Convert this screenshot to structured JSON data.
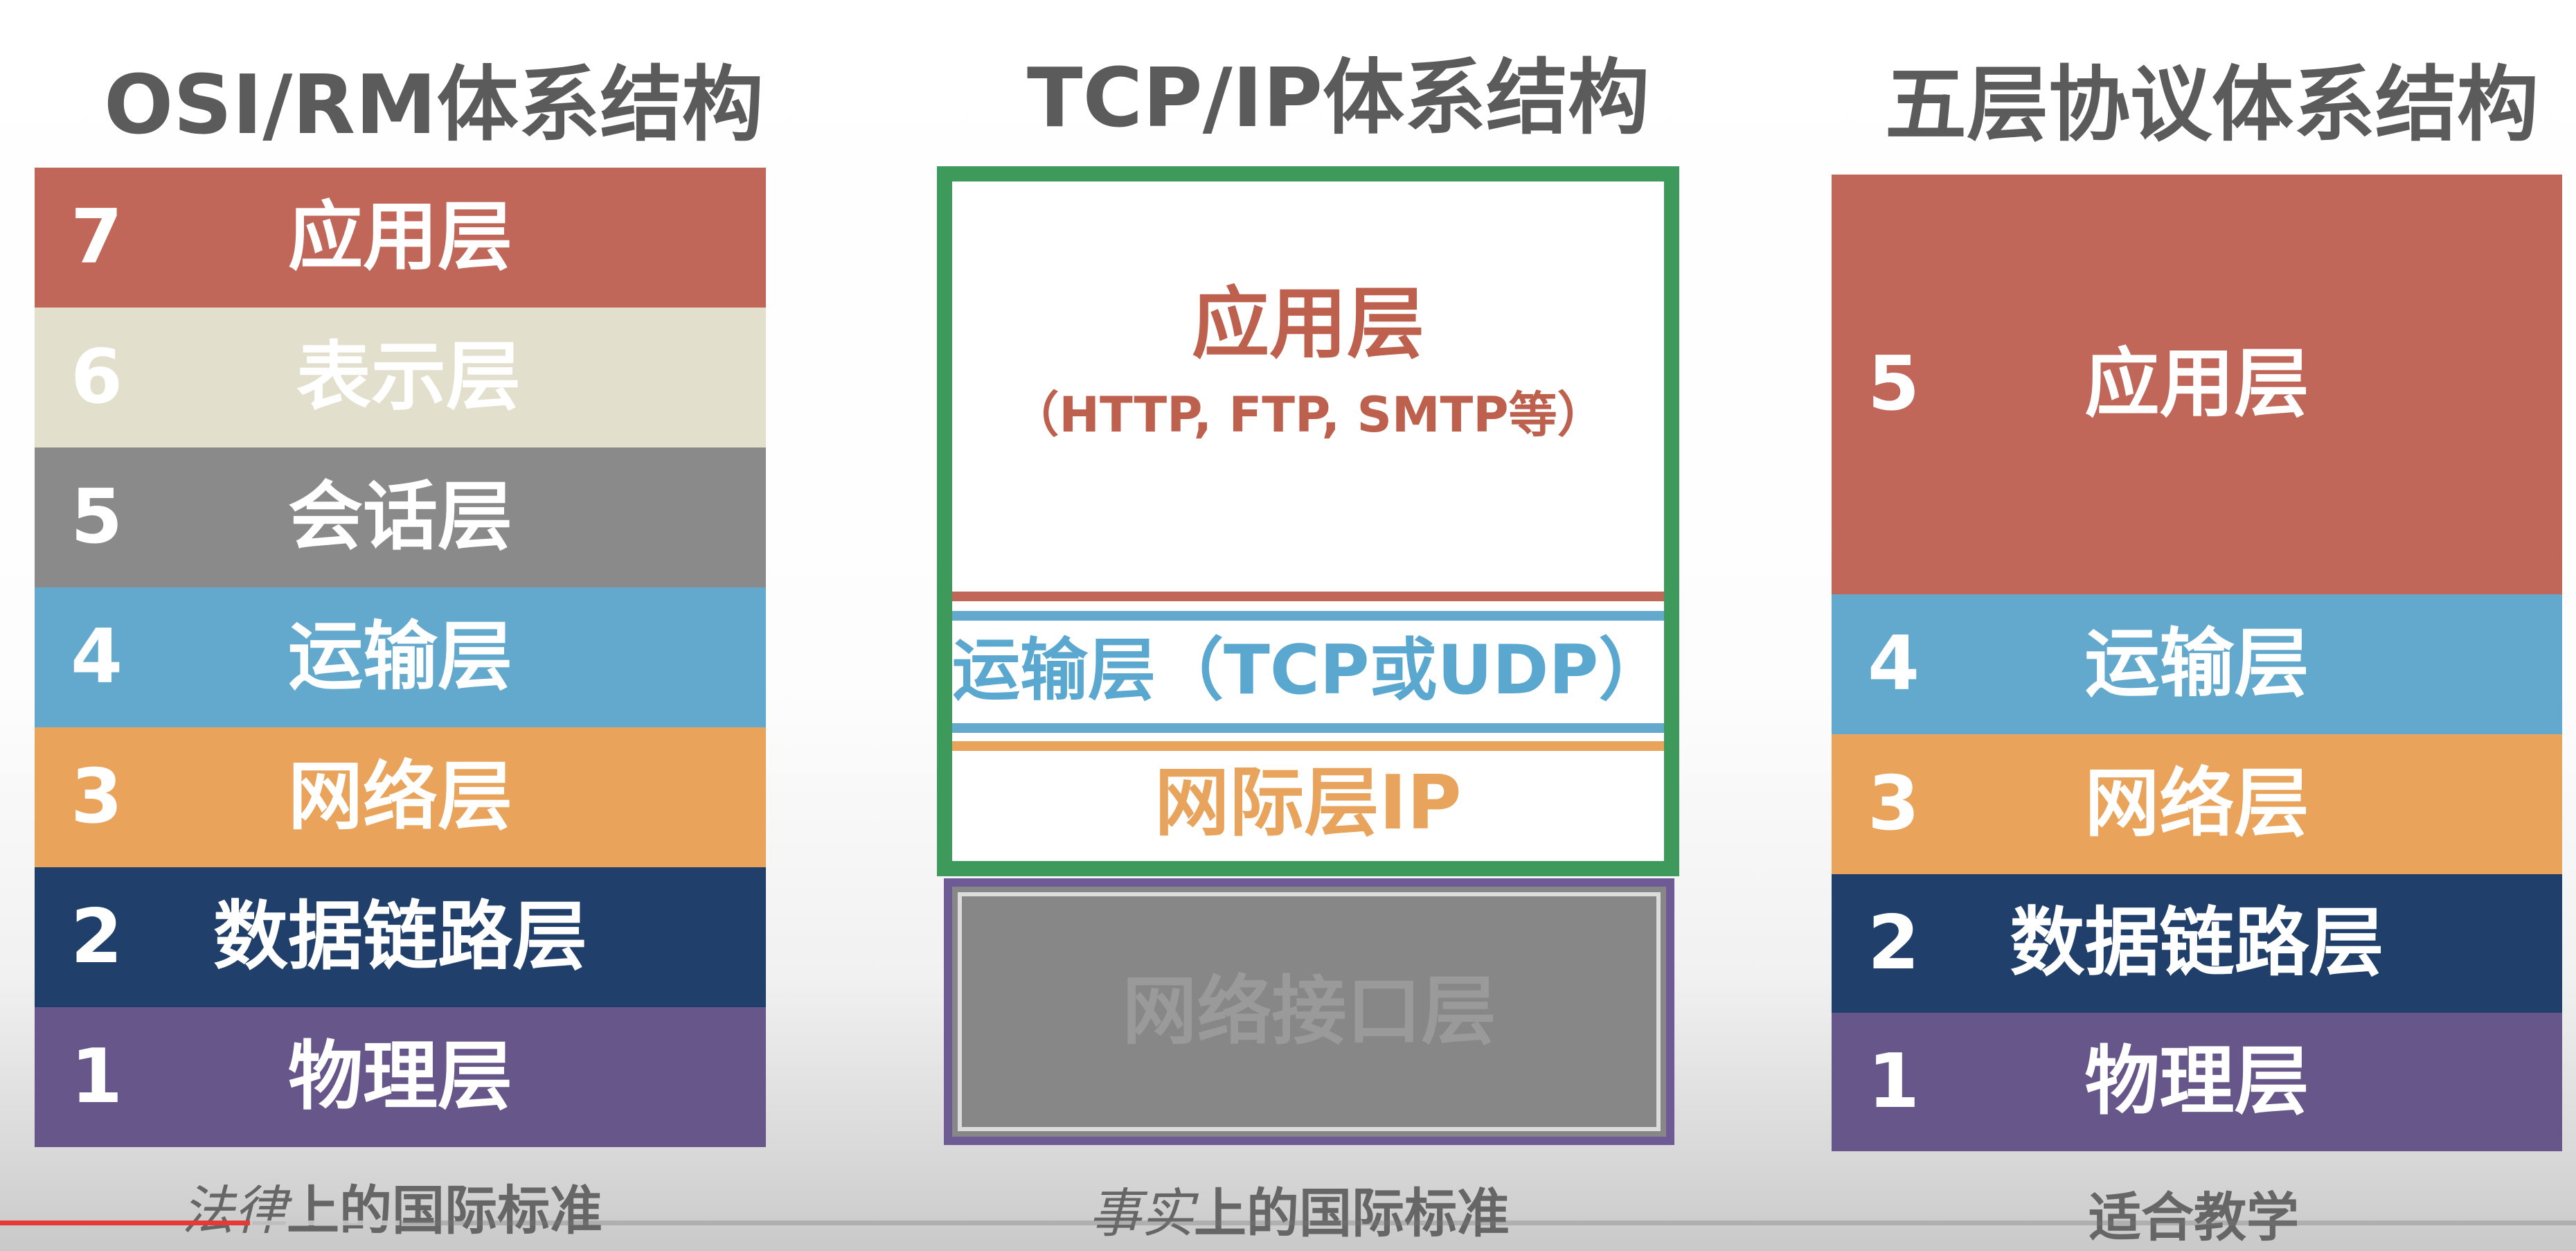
{
  "columns": {
    "osi": {
      "title": "OSI/RM体系结构",
      "layers": [
        {
          "num": "7",
          "name": "应用层",
          "color": "#c0675a"
        },
        {
          "num": "6",
          "name": "表示层",
          "color": "#e3dfcd"
        },
        {
          "num": "5",
          "name": "会话层",
          "color": "#8a8a8a"
        },
        {
          "num": "4",
          "name": "运输层",
          "color": "#62a9cd"
        },
        {
          "num": "3",
          "name": "网络层",
          "color": "#e9a35a"
        },
        {
          "num": "2",
          "name": "数据链路层",
          "color": "#203f6b"
        },
        {
          "num": "1",
          "name": "物理层",
          "color": "#67568a"
        }
      ],
      "caption_italic": "法律",
      "caption_rest": "上的国际标准"
    },
    "tcpip": {
      "title": "TCP/IP体系结构",
      "app_layer": "应用层",
      "app_protocols": "（HTTP, FTP, SMTP等）",
      "transport_layer": "运输层（TCP或UDP）",
      "internet_layer": "网际层IP",
      "network_interface_layer": "网络接口层",
      "caption_italic": "事实",
      "caption_rest": "上的国际标准",
      "frame_color": "#3e9a5a",
      "interface_border_color": "#6e5a95"
    },
    "five": {
      "title": "五层协议体系结构",
      "layers": [
        {
          "num": "5",
          "name": "应用层",
          "color": "#c0675a"
        },
        {
          "num": "4",
          "name": "运输层",
          "color": "#62a9cd"
        },
        {
          "num": "3",
          "name": "网络层",
          "color": "#e9a35a"
        },
        {
          "num": "2",
          "name": "数据链路层",
          "color": "#203f6b"
        },
        {
          "num": "1",
          "name": "物理层",
          "color": "#67568a"
        }
      ],
      "caption": "适合教学"
    }
  },
  "video_progress": {
    "played_fraction": 0.097,
    "buffered_fraction": 0.155,
    "played_color": "#e53935"
  }
}
